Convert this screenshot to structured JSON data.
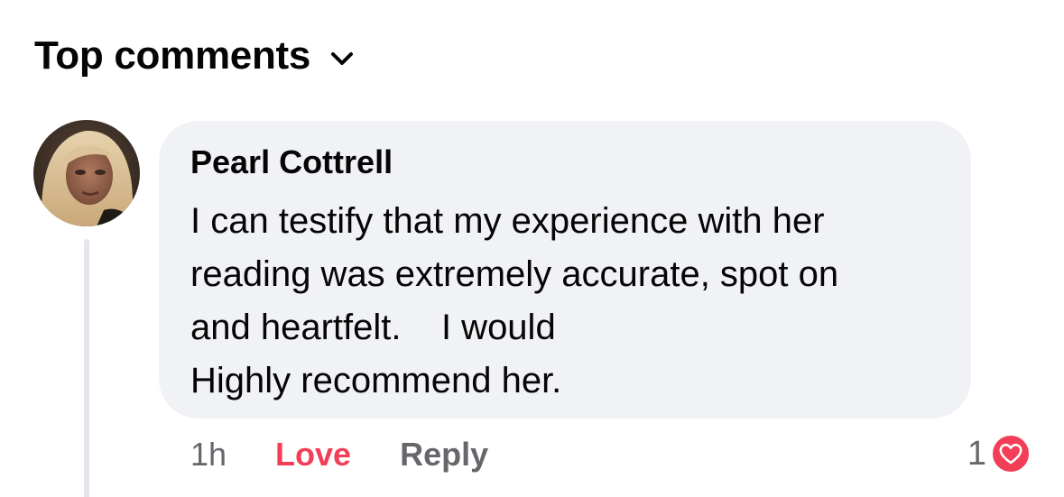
{
  "header": {
    "sort_label": "Top comments"
  },
  "comment": {
    "author": "Pearl Cottrell",
    "text": "I can testify that my experience with her\nreading was extremely accurate, spot on\nand heartfelt.    I would\nHighly recommend her.",
    "timestamp": "1h",
    "reaction_label": "Love",
    "reply_label": "Reply",
    "reaction_count": "1",
    "reaction_icon": "love-heart-icon"
  },
  "colors": {
    "bubble_bg": "#f0f2f5",
    "love_red": "#f33e58",
    "secondary_text": "#65676b",
    "primary_text": "#050505"
  }
}
